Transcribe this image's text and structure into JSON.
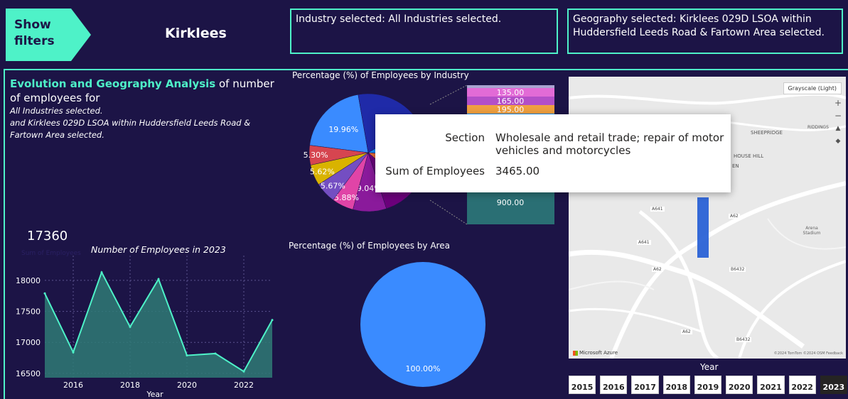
{
  "header": {
    "show_filters_label": "Show filters",
    "title": "Kirklees",
    "industry_selected": "Industry selected: All Industries selected.",
    "geography_selected": "Geography selected: Kirklees 029D LSOA within Huddersfield Leeds Road & Fartown Area selected."
  },
  "analysis": {
    "heading_highlight": "Evolution and Geography Analysis",
    "heading_rest": " of number of employees for",
    "line1": "All Industries selected.",
    "line2": "and Kirklees 029D LSOA within Huddersfield Leeds Road & Fartown Area selected."
  },
  "kpi": {
    "value": "17360",
    "label": "Sum of Employees"
  },
  "colors": {
    "accent": "#4ef2c8",
    "background": "#1c1446",
    "blue": "#3a8bff",
    "line_fill": "#2f7a76"
  },
  "chart_data": [
    {
      "type": "area",
      "title": "Number of Employees in 2023",
      "xlabel": "Year",
      "ylabel": "",
      "x": [
        2015,
        2016,
        2017,
        2018,
        2019,
        2020,
        2021,
        2022,
        2023
      ],
      "values": [
        17790,
        16840,
        18130,
        17250,
        18020,
        16790,
        16820,
        16530,
        17360
      ],
      "xlim": [
        2015,
        2023
      ],
      "ylim": [
        16430,
        18400
      ],
      "xticks": [
        "2016",
        "2018",
        "2020",
        "2022"
      ],
      "yticks": [
        "16500",
        "17000",
        "17500",
        "18000"
      ],
      "grid": true
    },
    {
      "type": "pie",
      "title": "Percentage (%) of Employees by Industry",
      "slices": [
        {
          "label": "19.96%",
          "value": 19.96,
          "color": "#3a8bff"
        },
        {
          "label": "",
          "value": 19.0,
          "color": "#1f2aa8"
        },
        {
          "label": "",
          "value": 9.5,
          "color": "#118dff"
        },
        {
          "label": "",
          "value": 10.0,
          "color": "#e66c37"
        },
        {
          "label": "",
          "value": 8.5,
          "color": "#6b007b"
        },
        {
          "label": "9.04%",
          "value": 9.04,
          "color": "#8a1a9b"
        },
        {
          "label": "5.88%",
          "value": 5.88,
          "color": "#e044a7"
        },
        {
          "label": "5.67%",
          "value": 5.67,
          "color": "#744ec2"
        },
        {
          "label": "5.62%",
          "value": 5.62,
          "color": "#d9b300"
        },
        {
          "label": "5.30%",
          "value": 5.3,
          "color": "#d64550"
        }
      ]
    },
    {
      "type": "bar",
      "title": "",
      "stack": [
        {
          "value": 135.0,
          "label": "135.00",
          "color": "#e26bd6"
        },
        {
          "value": 165.0,
          "label": "165.00",
          "color": "#b34fc8"
        },
        {
          "value": 195.0,
          "label": "195.00",
          "color": "#f0a040"
        },
        {
          "value": 900.0,
          "label": "900.00",
          "color": "#2a6f74"
        }
      ]
    },
    {
      "type": "pie",
      "title": "Percentage (%) of Employees by Area",
      "slices": [
        {
          "label": "100.00%",
          "value": 100.0,
          "color": "#3a8bff"
        }
      ]
    }
  ],
  "tooltip": {
    "section_key": "Section",
    "section_value_line1": "Wholesale and retail trade; repair of motor",
    "section_value_line2": "vehicles and motorcycles",
    "sum_key": "Sum of Employees",
    "sum_value": "3465.00"
  },
  "map": {
    "style_label": "Grayscale (Light)",
    "attribution": "Microsoft Azure",
    "credit": "©2024 TomTom ©2024 OSM Feedback",
    "labels": [
      "SHEEPRIDGE",
      "RIDDINGS",
      "HOUSE HILL",
      "EN",
      "A641",
      "A62",
      "A641",
      "A62",
      "B6432",
      "A62",
      "B6432",
      "Arena Stadium"
    ]
  },
  "year_slicer": {
    "title": "Year",
    "years": [
      "2015",
      "2016",
      "2017",
      "2018",
      "2019",
      "2020",
      "2021",
      "2022",
      "2023"
    ],
    "selected": "2023"
  }
}
